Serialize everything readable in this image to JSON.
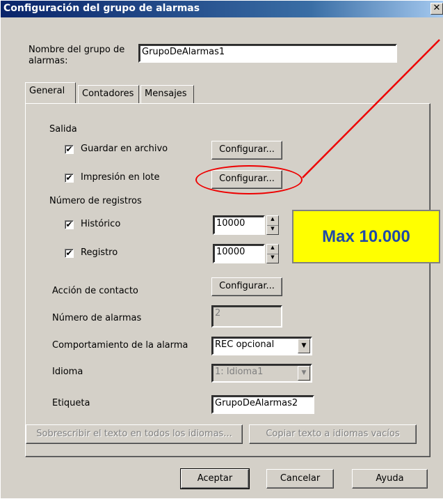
{
  "window": {
    "title": "Configuración del grupo de alarmas",
    "close_glyph": "✕"
  },
  "group_name": {
    "label": "Nombre del grupo de alarmas:",
    "value": "GrupoDeAlarmas1"
  },
  "tabs": [
    {
      "label": "General",
      "active": true
    },
    {
      "label": "Contadores",
      "active": false
    },
    {
      "label": "Mensajes",
      "active": false
    }
  ],
  "output": {
    "section_label": "Salida",
    "save_file": {
      "label": "Guardar en archivo",
      "checked": true,
      "button": "Configurar..."
    },
    "batch_print": {
      "label": "Impresión en lote",
      "checked": true,
      "button": "Configurar..."
    }
  },
  "records": {
    "section_label": "Número de registros",
    "history": {
      "label": "Histórico",
      "checked": true,
      "value": "10000"
    },
    "log": {
      "label": "Registro",
      "checked": true,
      "value": "10000"
    }
  },
  "contact_action": {
    "label": "Acción de contacto",
    "button": "Configurar..."
  },
  "alarm_count": {
    "label": "Número de alarmas",
    "value": "2"
  },
  "alarm_behavior": {
    "label": "Comportamiento de la alarma",
    "value": "REC opcional"
  },
  "language": {
    "label": "Idioma",
    "value": "1: Idioma1"
  },
  "tag": {
    "label": "Etiqueta",
    "value": "GrupoDeAlarmas2"
  },
  "text_buttons": {
    "overwrite": "Sobrescribir el texto en todos los idiomas...",
    "copy_empty": "Copiar texto a idiomas vacíos"
  },
  "footer": {
    "ok": "Aceptar",
    "cancel": "Cancelar",
    "help": "Ayuda"
  },
  "annotation": {
    "callout_text": "Max 10.000",
    "arrow_color": "#ee0000",
    "callout_bg": "#ffff00",
    "callout_text_color": "#1f4aa8"
  },
  "icons": {
    "checkbox": "check-mark",
    "spinner": "spin-arrows",
    "dropdown": "chevron-down-icon"
  },
  "glyphs": {
    "check": "✔",
    "up": "▲",
    "down": "▼"
  }
}
